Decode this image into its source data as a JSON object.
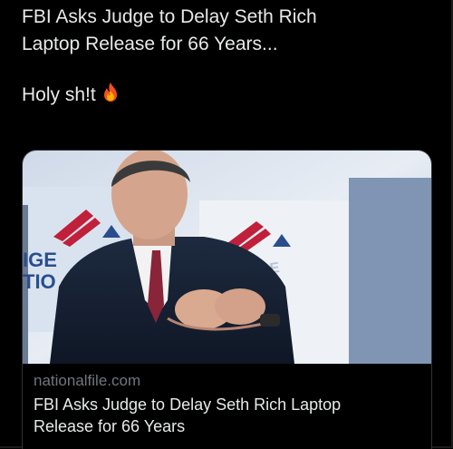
{
  "tweet": {
    "line1": "FBI Asks Judge to Delay Seth Rich",
    "line2": "Laptop Release for 66 Years...",
    "line3": "Holy sh!t",
    "emoji_icon": "fire-icon"
  },
  "link_card": {
    "domain": "nationalfile.com",
    "title_line1": "FBI Asks Judge to Delay Seth Rich Laptop",
    "title_line2": "Release for 66 Years",
    "stage_sign_left": "IGE",
    "stage_sign_left2": "TIO",
    "stage_sign_right": "ENCE"
  },
  "colors": {
    "background": "#000000",
    "text_primary": "#e7e9ea",
    "text_secondary": "#71767b",
    "card_border": "#2f3336",
    "logo_red": "#c0203a",
    "logo_blue": "#2a4e8c"
  }
}
